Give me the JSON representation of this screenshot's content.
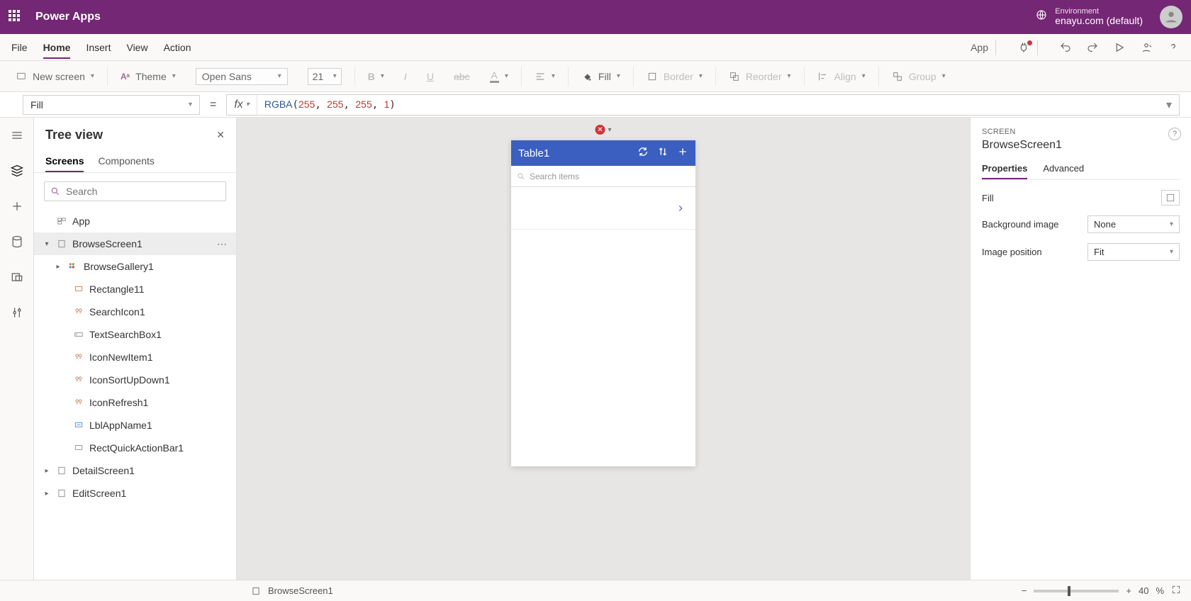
{
  "header": {
    "app_name": "Power Apps",
    "env_label": "Environment",
    "env_value": "enayu.com (default)"
  },
  "menu": {
    "items": [
      "File",
      "Home",
      "Insert",
      "View",
      "Action"
    ],
    "active": "Home",
    "right_app": "App"
  },
  "ribbon": {
    "new_screen": "New screen",
    "theme": "Theme",
    "font": "Open Sans",
    "font_size": "21",
    "fill": "Fill",
    "border": "Border",
    "reorder": "Reorder",
    "align": "Align",
    "group": "Group"
  },
  "formula_bar": {
    "property": "Fill",
    "fx_label": "fx",
    "fn": "RGBA",
    "args": "255, 255, 255, 1"
  },
  "tree": {
    "title": "Tree view",
    "tabs": [
      "Screens",
      "Components"
    ],
    "active_tab": "Screens",
    "search_placeholder": "Search",
    "items": {
      "app": "App",
      "browse_screen": "BrowseScreen1",
      "browse_gallery": "BrowseGallery1",
      "rectangle": "Rectangle11",
      "search_icon": "SearchIcon1",
      "text_search": "TextSearchBox1",
      "icon_new": "IconNewItem1",
      "icon_sort": "IconSortUpDown1",
      "icon_refresh": "IconRefresh1",
      "lbl_app": "LblAppName1",
      "rect_quick": "RectQuickActionBar1",
      "detail_screen": "DetailScreen1",
      "edit_screen": "EditScreen1"
    }
  },
  "canvas": {
    "phone_title": "Table1",
    "search_placeholder": "Search items"
  },
  "properties": {
    "category": "SCREEN",
    "name": "BrowseScreen1",
    "tabs": [
      "Properties",
      "Advanced"
    ],
    "active_tab": "Properties",
    "fill_label": "Fill",
    "bg_image_label": "Background image",
    "bg_image_value": "None",
    "img_pos_label": "Image position",
    "img_pos_value": "Fit"
  },
  "status": {
    "screen": "BrowseScreen1",
    "zoom": "40",
    "zoom_unit": "%"
  }
}
